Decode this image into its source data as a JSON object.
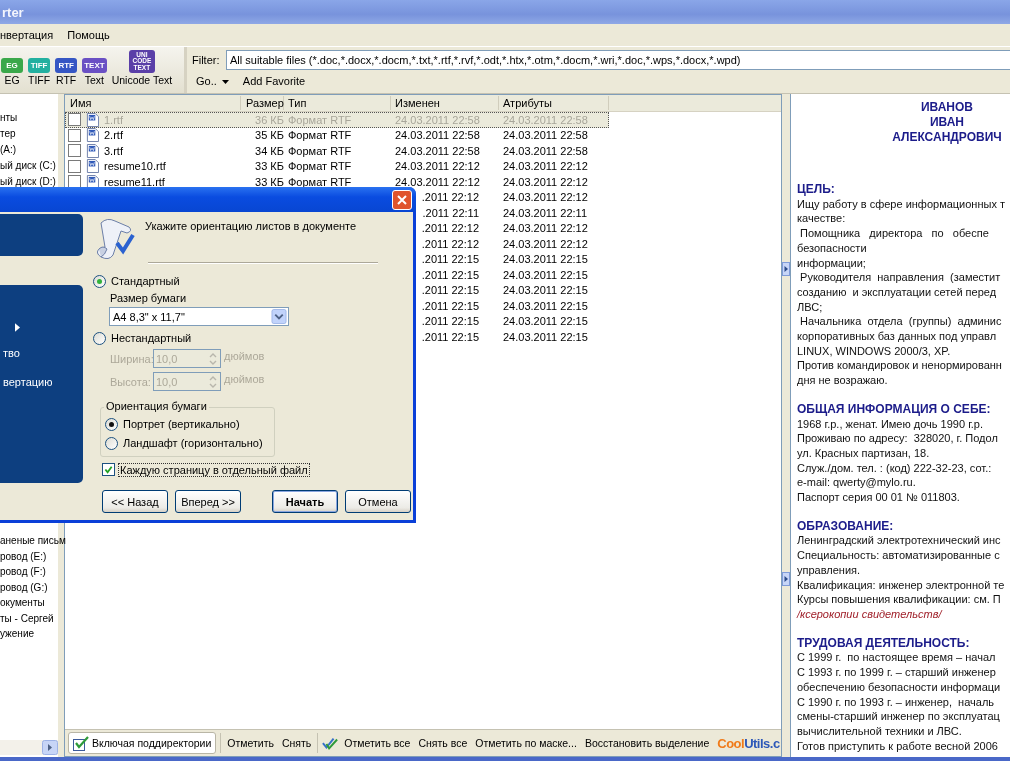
{
  "window": {
    "title": "rter"
  },
  "menu": [
    "нвертация",
    "Помощь"
  ],
  "format_buttons": [
    {
      "badge": "EG",
      "label": "EG",
      "color": "#3aa84a"
    },
    {
      "badge": "TIFF",
      "label": "TIFF",
      "color": "#22b0a0"
    },
    {
      "badge": "RTF",
      "label": "RTF",
      "color": "#3556c4"
    },
    {
      "badge": "TEXT",
      "label": "Text",
      "color": "#6a50c4"
    },
    {
      "badge": "UNI CODE TEXT",
      "label": "Unicode Text",
      "color": "#5a3fa8"
    }
  ],
  "filter": {
    "label": "Filter:",
    "value": "All suitable files (*.doc,*.docx,*.docm,*.txt,*.rtf,*.rvf,*.odt,*.htx,*.otm,*.docm,*.wri,*.doc,*.wps,*.docx,*.wpd)"
  },
  "go_button": "Go..",
  "add_favorite": "Add Favorite",
  "tree": {
    "top_items": [
      "нты",
      "тер",
      "(A:)",
      "ый диск (C:)",
      "ый диск (D:)"
    ],
    "bottom_items": [
      "аненые письм",
      "ровод (E:)",
      "ровод (F:)",
      "ровод (G:)",
      "окументы",
      "ты - Сергей",
      "ужение"
    ]
  },
  "file_list": {
    "columns": [
      "Имя",
      "Размер",
      "Тип",
      "Изменен",
      "Атрибуты"
    ],
    "rows": [
      {
        "selected": true,
        "checked": false,
        "name": "1.rtf",
        "size": "36 КБ",
        "type": "Формат RTF",
        "modified": "24.03.2011 22:58",
        "attributes": "24.03.2011 22:58"
      },
      {
        "selected": false,
        "checked": false,
        "name": "2.rtf",
        "size": "35 КБ",
        "type": "Формат RTF",
        "modified": "24.03.2011 22:58",
        "attributes": "24.03.2011 22:58"
      },
      {
        "selected": false,
        "checked": false,
        "name": "3.rtf",
        "size": "34 КБ",
        "type": "Формат RTF",
        "modified": "24.03.2011 22:58",
        "attributes": "24.03.2011 22:58"
      },
      {
        "selected": false,
        "checked": false,
        "name": "resume10.rtf",
        "size": "33 КБ",
        "type": "Формат RTF",
        "modified": "24.03.2011 22:12",
        "attributes": "24.03.2011 22:12"
      },
      {
        "selected": false,
        "checked": false,
        "name": "resume11.rtf",
        "size": "33 КБ",
        "type": "Формат RTF",
        "modified": "24.03.2011 22:12",
        "attributes": "24.03.2011 22:12"
      },
      {
        "selected": false,
        "modified": ".2011 22:12",
        "attributes": "24.03.2011 22:12"
      },
      {
        "selected": false,
        "modified": ".2011 22:11",
        "attributes": "24.03.2011 22:11"
      },
      {
        "selected": false,
        "modified": ".2011 22:12",
        "attributes": "24.03.2011 22:12"
      },
      {
        "selected": false,
        "modified": ".2011 22:12",
        "attributes": "24.03.2011 22:12"
      },
      {
        "selected": false,
        "modified": ".2011 22:15",
        "attributes": "24.03.2011 22:15"
      },
      {
        "selected": false,
        "modified": ".2011 22:15",
        "attributes": "24.03.2011 22:15"
      },
      {
        "selected": false,
        "modified": ".2011 22:15",
        "attributes": "24.03.2011 22:15"
      },
      {
        "selected": false,
        "modified": ".2011 22:15",
        "attributes": "24.03.2011 22:15"
      },
      {
        "selected": false,
        "modified": ".2011 22:15",
        "attributes": "24.03.2011 22:15"
      },
      {
        "selected": false,
        "modified": ".2011 22:15",
        "attributes": "24.03.2011 22:15"
      }
    ]
  },
  "bottom_bar": {
    "include_subdirs": "Включая поддиректории",
    "mark_group": [
      "Отметить",
      "Снять"
    ],
    "all_group": [
      "Отметить все",
      "Снять все",
      "Отметить по маске...",
      "Восстановить выделение"
    ],
    "logo": {
      "part_1": "Cool",
      "part_2": "Utils.c"
    }
  },
  "preview": {
    "title_lines": [
      "ИВАНОВ",
      "ИВАН",
      "АЛЕКСАНДРОВИЧ"
    ],
    "sections": [
      {
        "heading": "ЦЕЛЬ:",
        "lines": [
          {
            "kind": "text",
            "text": "Ищу работу в сфере информационных т"
          },
          {
            "kind": "text",
            "text": "качестве:"
          },
          {
            "kind": "text",
            "text": " Помощника   директора   по   обеспе"
          },
          {
            "kind": "text",
            "text": "безопасности"
          },
          {
            "kind": "text",
            "text": "информации;"
          },
          {
            "kind": "text",
            "text": " Руководителя  направления  (заместит"
          },
          {
            "kind": "text",
            "text": "созданию  и эксплуатации сетей перед"
          },
          {
            "kind": "text",
            "text": "ЛВС;"
          },
          {
            "kind": "text",
            "text": " Начальника  отдела  (группы)  админис"
          },
          {
            "kind": "text",
            "text": "корпоративных баз данных под управл"
          },
          {
            "kind": "text",
            "text": "LINUX, WINDOWS 2000/3, XP."
          },
          {
            "kind": "text",
            "text": "Против командировок и ненормированн"
          },
          {
            "kind": "text",
            "text": "дня не возражаю."
          }
        ]
      },
      {
        "heading": "ОБЩАЯ ИНФОРМАЦИЯ О СЕБЕ:",
        "lines": [
          {
            "kind": "text",
            "text": "1968 г.р., женат. Имею дочь 1990 г.р."
          },
          {
            "kind": "text",
            "text": "Проживаю по адресу:  328020, г. Подол"
          },
          {
            "kind": "text",
            "text": "ул. Красных партизан, 18."
          },
          {
            "kind": "text",
            "text": "Служ./дом. тел. : (код) 222-32-23, сот.:"
          },
          {
            "kind": "text",
            "text": "e-mail: qwerty@mylo.ru."
          },
          {
            "kind": "text",
            "text": "Паспорт серия 00 01 № 011803."
          }
        ]
      },
      {
        "heading": "ОБРАЗОВАНИЕ:",
        "lines": [
          {
            "kind": "text",
            "text": "Ленинградский электротехнический инс"
          },
          {
            "kind": "text",
            "text": "Специальность: автоматизированные с"
          },
          {
            "kind": "text",
            "text": "управления."
          },
          {
            "kind": "text",
            "text": "Квалификация: инженер электронной те"
          },
          {
            "kind": "text",
            "text": "Курсы повышения квалификации: см. П"
          },
          {
            "kind": "note",
            "text": "/ксерокопии свидетельств/"
          }
        ]
      },
      {
        "heading": "ТРУДОВАЯ ДЕЯТЕЛЬНОСТЬ:",
        "lines": [
          {
            "kind": "text",
            "text": "С 1999 г.  по настоящее время – начал"
          },
          {
            "kind": "text",
            "text": "С 1993 г. по 1999 г. – старший инженер"
          },
          {
            "kind": "text",
            "text": "обеспечению безопасности информаци"
          },
          {
            "kind": "text",
            "text": "С 1990 г. по 1993 г. – инженер,  началь"
          },
          {
            "kind": "text",
            "text": "смены-старший инженер по эксплуатац"
          },
          {
            "kind": "text",
            "text": "вычислительной техники и ЛВС."
          },
          {
            "kind": "text",
            "text": "Готов приступить к работе весной 2006"
          }
        ]
      }
    ]
  },
  "dialog": {
    "side_items": [
      {
        "kind": "submenu"
      },
      {
        "kind": "text",
        "label": "тво"
      },
      {
        "kind": "text",
        "label": "вертацию"
      }
    ],
    "prompt": "Укажите ориентацию листов в документе",
    "standard": {
      "label": "Стандартный",
      "selected": true
    },
    "paper_size": {
      "label": "Размер бумаги",
      "value": "A4 8,3\" x 11,7\""
    },
    "custom": {
      "label": "Нестандартный",
      "selected": false
    },
    "custom_fields": [
      {
        "label": "Ширина:",
        "value": "10,0",
        "unit": "дюймов",
        "disabled": true
      },
      {
        "label": "Высота:",
        "value": "10,0",
        "unit": "дюймов",
        "disabled": true
      }
    ],
    "orientation": {
      "title": "Ориентация бумаги",
      "options": [
        {
          "label": "Портрет (вертикально)",
          "selected": true
        },
        {
          "label": "Ландшафт (горизонтально)",
          "selected": false
        }
      ]
    },
    "separate_files": {
      "label": "Каждую страницу в отдельный файл",
      "checked": true
    },
    "nav_buttons": [
      {
        "label": "<< Назад",
        "default": false
      },
      {
        "label": "Вперед >>",
        "default": false
      }
    ],
    "action_buttons": [
      {
        "label": "Начать",
        "default": true
      },
      {
        "label": "Отмена",
        "default": false
      }
    ]
  }
}
